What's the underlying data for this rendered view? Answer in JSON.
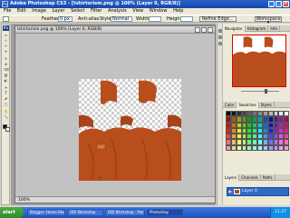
{
  "window": {
    "title": "Adobe Photoshop CS3 - [tshirtorism.png @ 100% (Layer 0, RGB/8)]",
    "controls": {
      "minimize": "_",
      "maximize": "□",
      "close": "×"
    }
  },
  "menu": [
    "File",
    "Edit",
    "Image",
    "Layer",
    "Select",
    "Filter",
    "Analysis",
    "View",
    "Window",
    "Help"
  ],
  "options_bar": {
    "feather_label": "Feather:",
    "feather_value": "0 px",
    "anti_alias_label": "Anti-alias",
    "style_label": "Style:",
    "style_value": "Normal",
    "width_label": "Width:",
    "height_label": "Height:",
    "refine_edge_button": "Refine Edge...",
    "workspace_button": "Workspace ▾"
  },
  "toolbox": {
    "logo": "Ps",
    "tools": [
      "▭",
      "⊹",
      "✄",
      "⌖",
      "✎",
      "⊕",
      "⌫",
      "▨",
      "◐",
      "✦",
      "T",
      "⬈",
      "▢",
      "✋",
      "🔍"
    ]
  },
  "document": {
    "title": "tshirtorism.png @ 100% (Layer 0, RGB/8)",
    "status": "100%"
  },
  "panels": {
    "navigator_tabs": [
      "Navigator",
      "Histogram",
      "Info"
    ],
    "color_tabs": [
      "Color",
      "Swatches",
      "Styles"
    ],
    "layers_tabs": [
      "Layers",
      "Channels",
      "Paths"
    ],
    "layer_name": "Layer 0"
  },
  "taskbar": {
    "start_label": "start",
    "tasks": [
      "Blogger: Home Blog...",
      "ODI Workshop",
      "ODI Workshop - Paint",
      "Photoshop"
    ],
    "clock": "11:37"
  },
  "colors": {
    "shirt": "#b84e1c",
    "shirt_dark": "#8e3610",
    "selection_blue": "#316ac5"
  }
}
